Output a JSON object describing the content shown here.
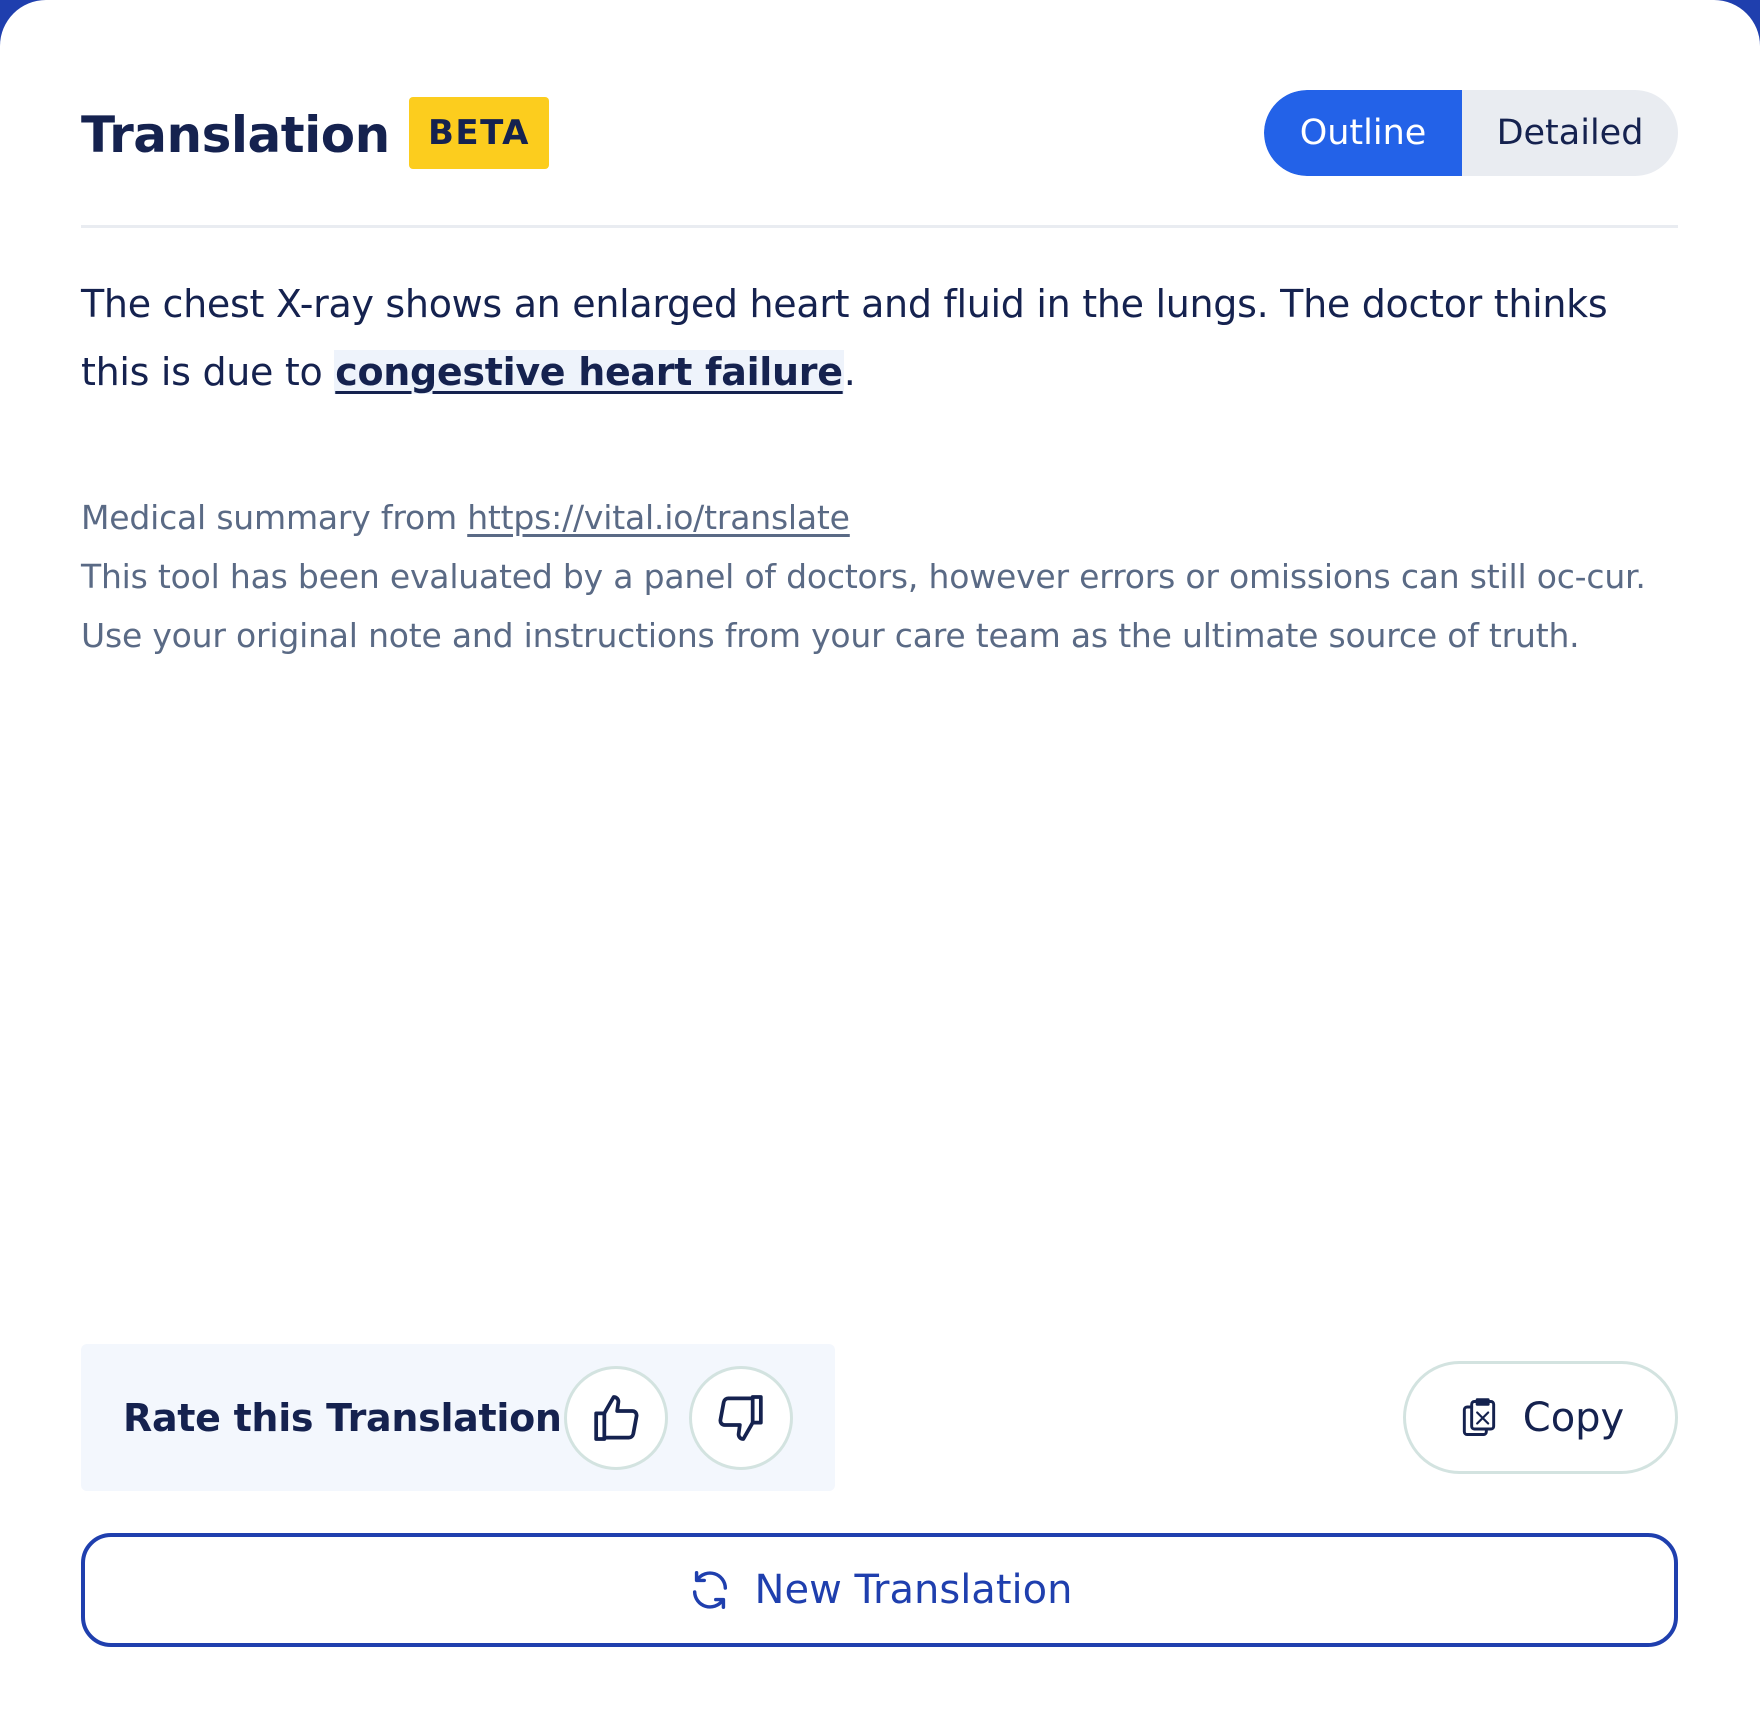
{
  "header": {
    "title": "Translation",
    "badge": "BETA",
    "toggle": {
      "options": [
        "Outline",
        "Detailed"
      ],
      "selected": "Outline"
    }
  },
  "summary": {
    "text_before": "The chest X-ray shows an enlarged heart and fluid in the lungs. The doctor thinks this is due to ",
    "term": "congestive heart failure",
    "text_after": "."
  },
  "note": {
    "source_prefix": "Medical summary from ",
    "source_link": "https://vital.io/translate",
    "disclaimer": "This tool has been evaluated by a panel of doctors, however errors or omissions can still oc-cur. Use your original note and instructions from your care team as the ultimate source of truth."
  },
  "rating": {
    "label": "Rate this Translation",
    "icons": [
      "thumbs-up-icon",
      "thumbs-down-icon"
    ]
  },
  "copy": {
    "label": "Copy",
    "icon": "clipboard-icon"
  },
  "new_translation": {
    "label": "New Translation",
    "icon": "refresh-icon"
  },
  "colors": {
    "brand_blue": "#2362e8",
    "navy": "#15224f",
    "badge_yellow": "#fccd1e",
    "outline_blue": "#1f3fae",
    "muted_text": "#5a6a85"
  }
}
